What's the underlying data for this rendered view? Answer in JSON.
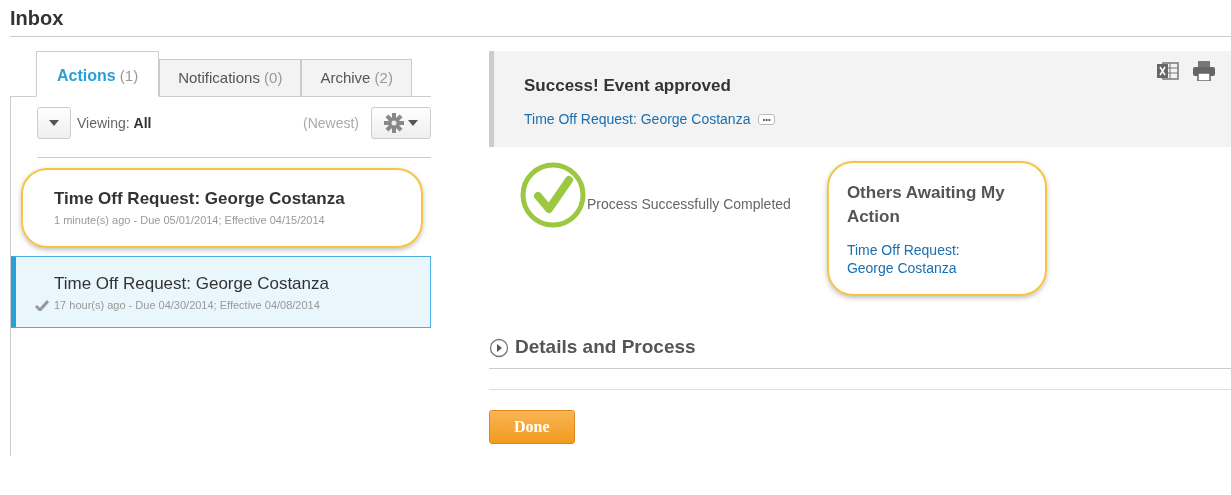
{
  "page_title": "Inbox",
  "tabs": [
    {
      "label": "Actions",
      "count": "(1)",
      "selected": true
    },
    {
      "label": "Notifications",
      "count": "(0)",
      "selected": false
    },
    {
      "label": "Archive",
      "count": "(2)",
      "selected": false
    }
  ],
  "toolbar": {
    "viewing_label": "Viewing:",
    "viewing_value": "All",
    "sort": "(Newest)"
  },
  "items": [
    {
      "title": "Time Off Request: George Costanza",
      "meta": "1 minute(s) ago - Due 05/01/2014; Effective 04/15/2014",
      "selected": false,
      "read": false,
      "highlighted": true
    },
    {
      "title": "Time Off Request: George Costanza",
      "meta": "17 hour(s) ago - Due 04/30/2014; Effective 04/08/2014",
      "selected": true,
      "read": true,
      "highlighted": false
    }
  ],
  "message": {
    "title": "Success! Event approved",
    "link": "Time Off Request: George Costanza",
    "more": "•••"
  },
  "status": "Process Successfully Completed",
  "others": {
    "title": "Others Awaiting My Action",
    "link": "Time Off Request: George Costanza",
    "highlighted": true
  },
  "section": {
    "title": "Details and Process",
    "expanded": false
  },
  "done_button": "Done"
}
